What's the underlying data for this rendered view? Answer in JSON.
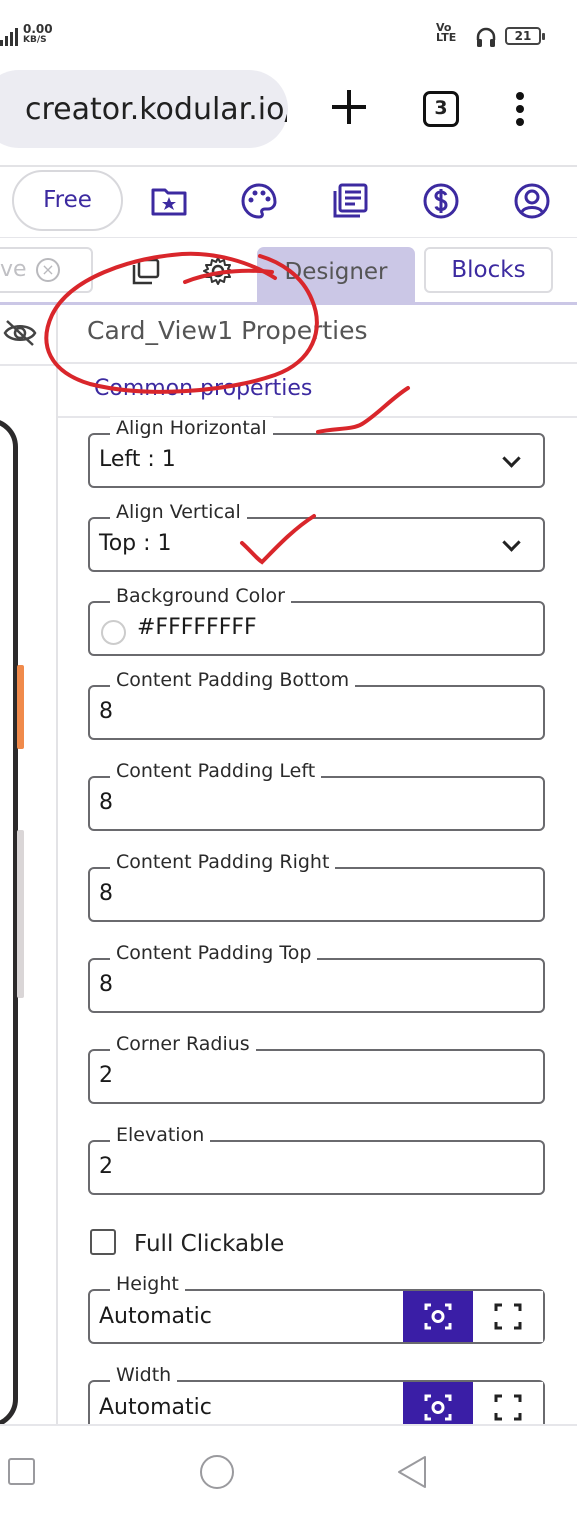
{
  "status_bar": {
    "net_speed": "0.00",
    "net_unit": "KB/S",
    "volte_top": "Vo",
    "volte_bottom": "LTE",
    "battery": "21"
  },
  "browser": {
    "url": "creator.kodular.io/",
    "tab_count": "3"
  },
  "toolbar": {
    "plan_label": "Free"
  },
  "tabs_row": {
    "search_fragment": "ve",
    "designer_label": "Designer",
    "blocks_label": "Blocks"
  },
  "properties": {
    "title": "Card_View1 Properties",
    "section": "Common properties",
    "align_horizontal": {
      "label": "Align Horizontal",
      "value": "Left : 1"
    },
    "align_vertical": {
      "label": "Align Vertical",
      "value": "Top : 1"
    },
    "background_color": {
      "label": "Background Color",
      "value": "#FFFFFFFF"
    },
    "padding_bottom": {
      "label": "Content Padding Bottom",
      "value": "8"
    },
    "padding_left": {
      "label": "Content Padding Left",
      "value": "8"
    },
    "padding_right": {
      "label": "Content Padding Right",
      "value": "8"
    },
    "padding_top": {
      "label": "Content Padding Top",
      "value": "8"
    },
    "corner_radius": {
      "label": "Corner Radius",
      "value": "2"
    },
    "elevation": {
      "label": "Elevation",
      "value": "2"
    },
    "full_clickable": {
      "label": "Full Clickable",
      "checked": false
    },
    "height": {
      "label": "Height",
      "value": "Automatic"
    },
    "width": {
      "label": "Width",
      "value": "Automatic"
    }
  },
  "colors": {
    "accent": "#3a1ea6",
    "tab_active": "#cbc7e6",
    "annotation": "#d9262b"
  },
  "icons": [
    "signal-icon",
    "headphones-icon",
    "plus-icon",
    "kebab-menu-icon",
    "folder-star-icon",
    "palette-icon",
    "news-icon",
    "dollar-icon",
    "account-icon",
    "copy-icon",
    "gear-icon",
    "eye-off-icon",
    "chevron-down-icon",
    "focus-icon",
    "fullscreen-icon"
  ]
}
